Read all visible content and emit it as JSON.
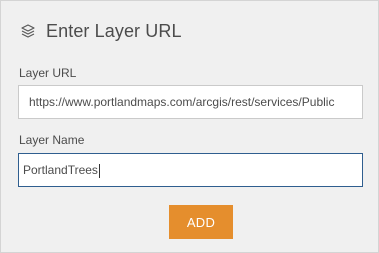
{
  "dialog": {
    "icon": "layers-icon",
    "title": "Enter Layer URL"
  },
  "fields": {
    "url_label": "Layer URL",
    "url_value": "https://www.portlandmaps.com/arcgis/rest/services/Public",
    "name_label": "Layer Name",
    "name_value": "PortlandTrees"
  },
  "actions": {
    "add_label": "ADD",
    "add_color": "#e58e2d"
  }
}
